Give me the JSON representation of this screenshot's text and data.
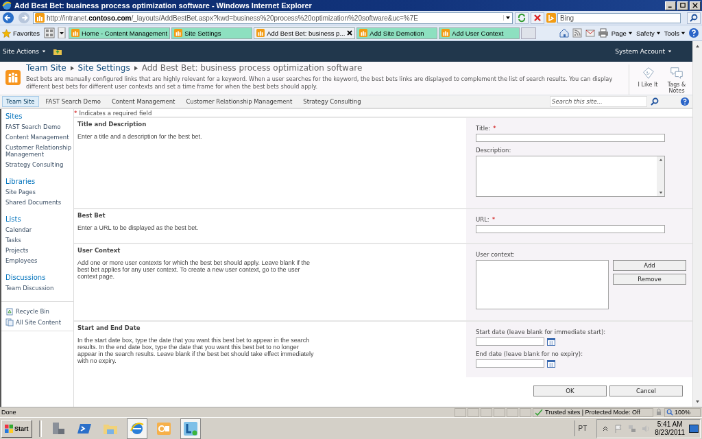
{
  "window": {
    "title": "Add Best Bet: business process optimization software - Windows Internet Explorer"
  },
  "address_bar": {
    "url": "http://intranet.**contoso.com**/_layouts/AddBestBet.aspx?kwd=business%20process%20optimization%20software&uc=%7E",
    "search_placeholder": "Bing"
  },
  "favorites": {
    "label": "Favorites"
  },
  "tabs": [
    {
      "label": "Home - Content Management",
      "selected": false
    },
    {
      "label": "Site Settings",
      "selected": false
    },
    {
      "label": "Add Best Bet: business p...",
      "selected": true
    },
    {
      "label": "Add Site Demotion",
      "selected": false
    },
    {
      "label": "Add User Context",
      "selected": false
    }
  ],
  "command_bar": [
    "Page",
    "Safety",
    "Tools"
  ],
  "ribbon": {
    "site_actions": "Site Actions",
    "user": "System Account"
  },
  "header": {
    "breadcrumb": [
      "Team Site",
      "Site Settings",
      "Add Best Bet: business process optimization software"
    ],
    "description": "Best bets are manually configured links that are highly relevant for a keyword. When a user searches for the keyword, the best bets links are displayed to complement the list of search results. You can display different best bets for different user contexts and set a time frame for when the best bets should apply.",
    "actions": [
      "I Like It",
      "Tags & Notes"
    ]
  },
  "top_nav": {
    "items": [
      {
        "label": "Team Site",
        "selected": true
      },
      {
        "label": "FAST Search Demo",
        "selected": false
      },
      {
        "label": "Content Management",
        "selected": false
      },
      {
        "label": "Customer Relationship Management",
        "selected": false
      },
      {
        "label": "Strategy Consulting",
        "selected": false
      }
    ],
    "search_placeholder": "Search this site..."
  },
  "quick_launch": {
    "sections": [
      {
        "heading": "Sites",
        "items": [
          "FAST Search Demo",
          "Content Management",
          "Customer Relationship Management",
          "Strategy Consulting"
        ]
      },
      {
        "heading": "Libraries",
        "items": [
          "Site Pages",
          "Shared Documents"
        ]
      },
      {
        "heading": "Lists",
        "items": [
          "Calendar",
          "Tasks",
          "Projects",
          "Employees"
        ]
      },
      {
        "heading": "Discussions",
        "items": [
          "Team Discussion"
        ]
      }
    ],
    "footer": [
      "Recycle Bin",
      "All Site Content"
    ]
  },
  "form": {
    "required_mark": "*",
    "required_note": "Indicates a required field",
    "sections": [
      {
        "title": "Title and Description",
        "description": "Enter a title and a description for the best bet.",
        "fields": [
          {
            "kind": "text",
            "label": "Title:",
            "required": true
          },
          {
            "kind": "textarea",
            "label": "Description:",
            "required": false
          }
        ]
      },
      {
        "title": "Best Bet",
        "description": "Enter a URL to be displayed as the best bet.",
        "fields": [
          {
            "kind": "text",
            "label": "URL:",
            "required": true
          }
        ]
      },
      {
        "title": "User Context",
        "description": "Add one or more user contexts for which the best bet should apply.  Leave blank if the best bet applies for any user context. To create a new user context, go to the user context page.",
        "fields": [
          {
            "kind": "listbox",
            "label": "User context:",
            "required": false,
            "buttons": [
              "Add",
              "Remove"
            ]
          }
        ]
      },
      {
        "title": "Start and End Date",
        "description": "In the start date box, type the date that you want this best bet to appear in the search results. In the end date box, type the date that you want this best bet to no longer appear in the search results. Leave blank if the best bet should take effect immediately with no expiry.",
        "fields": [
          {
            "kind": "date",
            "label": "Start date (leave blank for immediate start):",
            "required": false
          },
          {
            "kind": "date",
            "label": "End date (leave blank for no expiry):",
            "required": false
          }
        ]
      }
    ],
    "buttons": [
      "OK",
      "Cancel"
    ]
  },
  "status_bar": {
    "text": "Done",
    "zone": "Trusted sites | Protected Mode: Off",
    "zoom": "100%"
  },
  "taskbar": {
    "start": "Start",
    "language": "PT",
    "time": "5:41 AM",
    "date": "8/23/2011"
  }
}
